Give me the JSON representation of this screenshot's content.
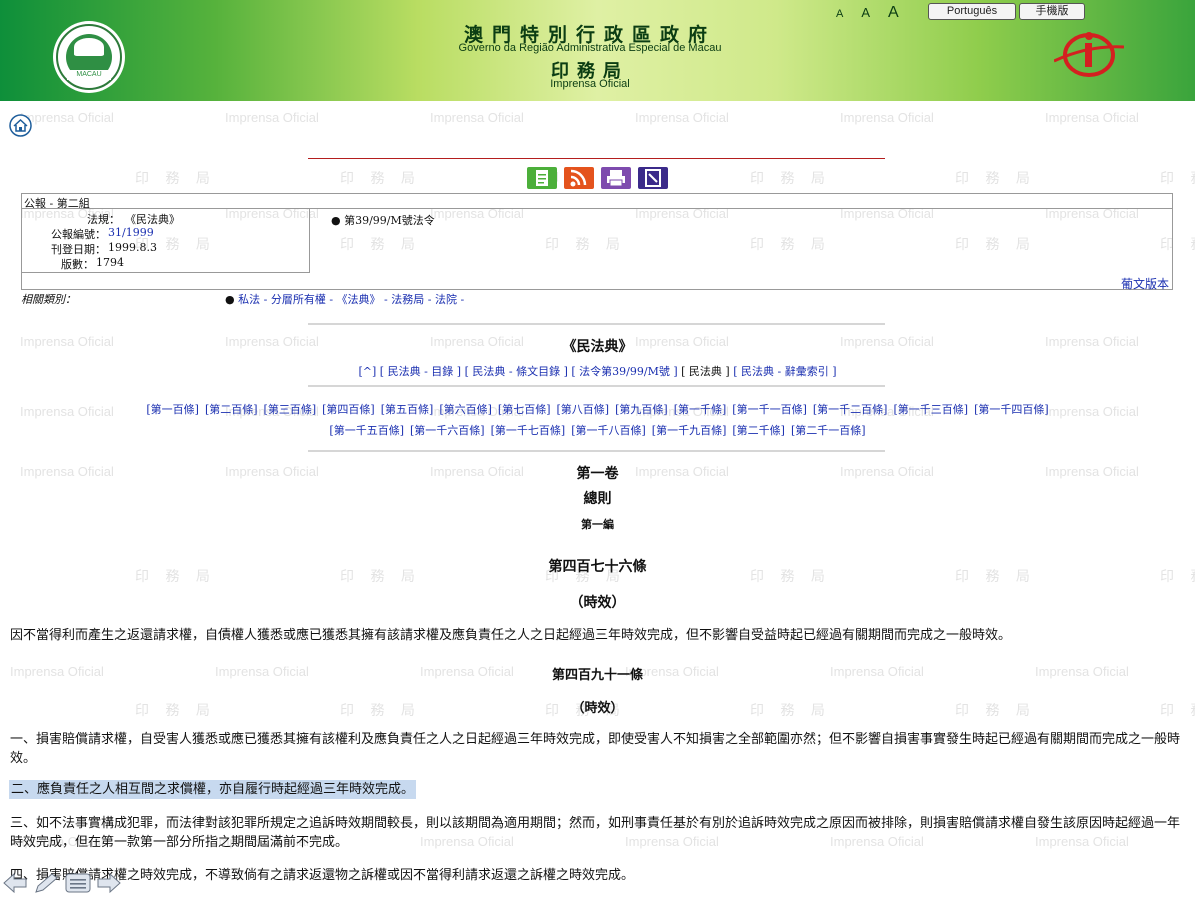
{
  "header": {
    "title_cn": "澳門特別行政區政府",
    "title_pt": "Governo da Região Administrativa Especial de Macau",
    "dept_cn": "印務局",
    "dept_pt": "Imprensa Oficial",
    "emblem_text": "MACAU",
    "font_sizes": [
      "A",
      "A",
      "A"
    ],
    "btn_portuguese": "Português",
    "btn_mobile": "手機版"
  },
  "watermark": {
    "pt": "Imprensa Oficial",
    "cn": "印 務 局"
  },
  "infobox": {
    "group": "公報 - 第二組",
    "law_label": "法規：",
    "law_value": "《民法典》",
    "number_label": "公報編號：",
    "number_value": "31/1999",
    "date_label": "刊登日期：",
    "date_value": "1999.8.3",
    "page_label": "版數：",
    "page_value": "1794",
    "decree": "第39/99/M號法令",
    "pt_version": "葡文版本"
  },
  "related": {
    "label": "相關類別：",
    "links": "私法 - 分層所有權 - 《法典》 - 法務局 - 法院 -"
  },
  "codex_title": "《民法典》",
  "nav_links": [
    "[^]",
    "[ 民法典 - 目錄 ]",
    "[ 民法典 - 條文目錄 ]",
    "[ 法令第39/99/M號 ]",
    "[ 民法典 ]",
    "[ 民法典 - 辭彙索引 ]"
  ],
  "article_links_row1": [
    "[第一百條]",
    "[第二百條]",
    "[第三百條]",
    "[第四百條]",
    "[第五百條]",
    "[第六百條]",
    "[第七百條]",
    "[第八百條]",
    "[第九百條]",
    "[第一千條]",
    "[第一千一百條]",
    "[第一千二百條]",
    "[第一千三百條]",
    "[第一千四百條]"
  ],
  "article_links_row2": [
    "[第一千五百條]",
    "[第一千六百條]",
    "[第一千七百條]",
    "[第一千八百條]",
    "[第一千九百條]",
    "[第二千條]",
    "[第二千一百條]"
  ],
  "book": "第一卷",
  "part": "總則",
  "title": "第一編",
  "art476": {
    "heading": "第四百七十六條",
    "sub": "（時效）"
  },
  "p1": "因不當得利而產生之返還請求權，自債權人獲悉或應已獲悉其擁有該請求權及應負責任之人之日起經過三年時效完成，但不影響自受益時起已經過有關期間而完成之一般時效。",
  "art491": {
    "heading": "第四百九十一條",
    "sub": "（時效）"
  },
  "p2": "一、損害賠償請求權，自受害人獲悉或應已獲悉其擁有該權利及應負責任之人之日起經過三年時效完成，即使受害人不知損害之全部範圍亦然；但不影響自損害事實發生時起已經過有關期間而完成之一般時效。",
  "p3": "二、應負責任之人相互間之求償權，亦自履行時起經過三年時效完成。",
  "p4": "三、如不法事實構成犯罪，而法律對該犯罪所規定之追訴時效期間較長，則以該期間為適用期間；然而，如刑事責任基於有別於追訴時效完成之原因而被排除，則損害賠償請求權自發生該原因時起經過一年時效完成，但在第一款第一部分所指之期間屆滿前不完成。",
  "p5": "四、損害賠償請求權之時效完成，不導致倘有之請求返還物之訴權或因不當得利請求返還之訴權之時效完成。",
  "colors": {
    "accent_blue": "#1a2fb0",
    "highlight": "#c7d9ef",
    "header_green": "#56b23c"
  }
}
